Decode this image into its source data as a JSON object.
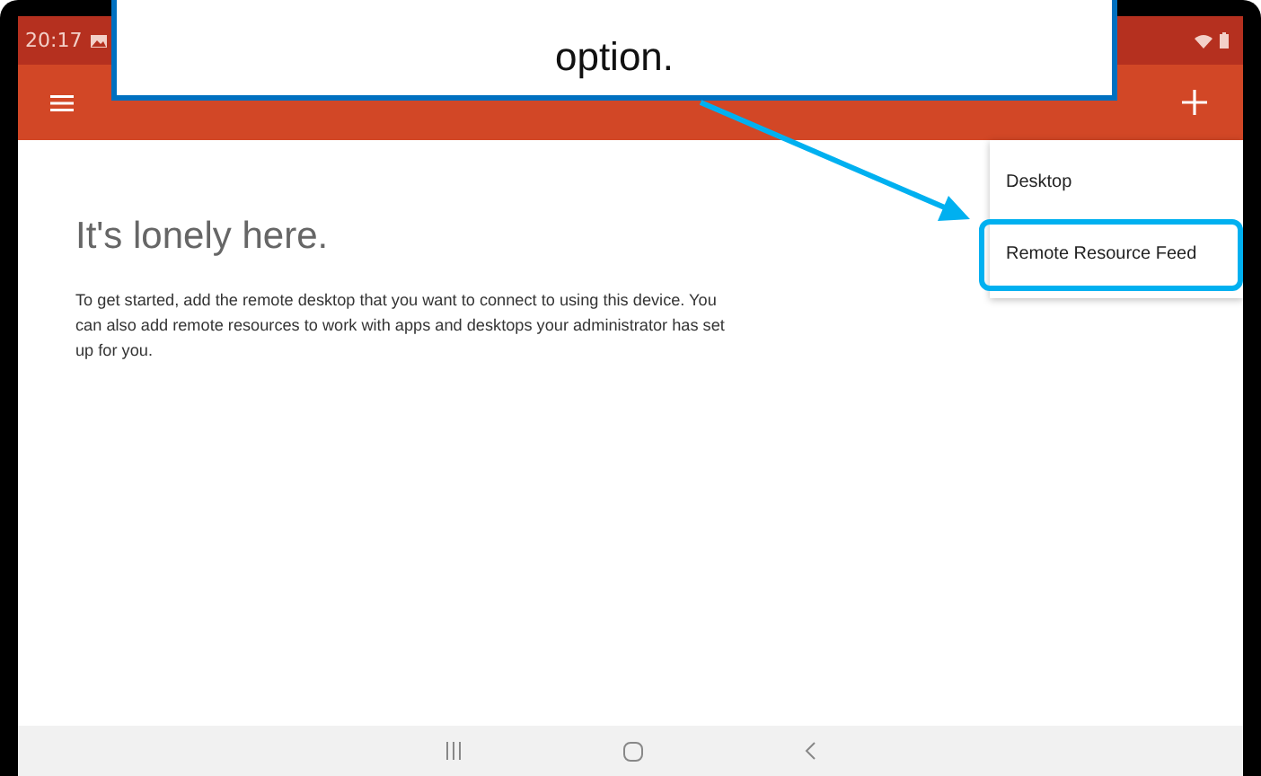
{
  "status_bar": {
    "time": "20:17"
  },
  "callout": {
    "text": "option."
  },
  "empty_state": {
    "heading": "It's lonely here.",
    "body": "To get started, add the remote desktop that you want to connect to using this device. You can also add remote resources to work with apps and desktops your administrator has set up for you."
  },
  "add_menu": {
    "items": [
      {
        "label": "Desktop",
        "highlighted": false
      },
      {
        "label": "Remote Resource Feed",
        "highlighted": true
      }
    ]
  }
}
